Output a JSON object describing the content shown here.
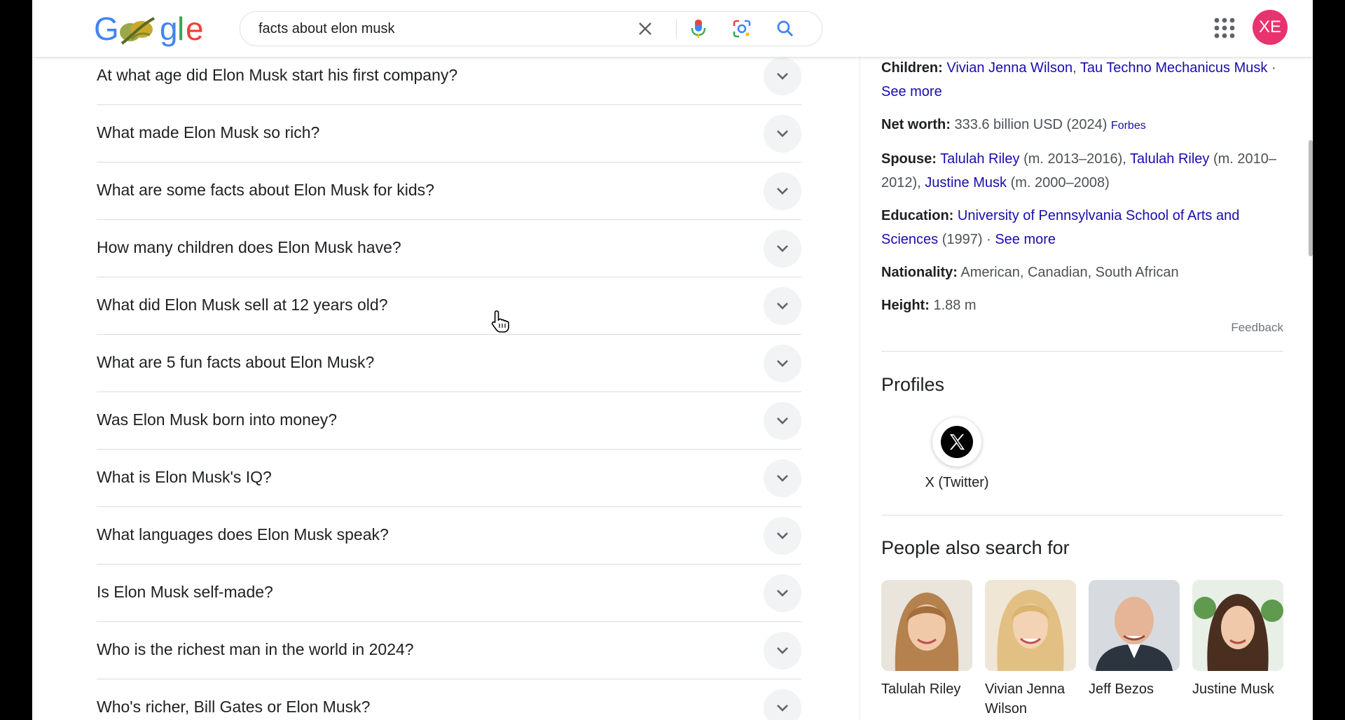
{
  "header": {
    "logo_text": "Google",
    "search_query": "facts about elon musk",
    "avatar_initials": "XE",
    "avatar_color": "#e8336e",
    "icons": [
      "clear-icon",
      "mic-icon",
      "lens-icon",
      "search-icon",
      "apps-icon"
    ]
  },
  "paa": {
    "questions": [
      "At what age did Elon Musk start his first company?",
      "What made Elon Musk so rich?",
      "What are some facts about Elon Musk for kids?",
      "How many children does Elon Musk have?",
      "What did Elon Musk sell at 12 years old?",
      "What are 5 fun facts about Elon Musk?",
      "Was Elon Musk born into money?",
      "What is Elon Musk's IQ?",
      "What languages does Elon Musk speak?",
      "Is Elon Musk self-made?",
      "Who is the richest man in the world in 2024?",
      "Who's richer, Bill Gates or Elon Musk?"
    ]
  },
  "knowledge_panel": {
    "children": {
      "label": "Children:",
      "link1": "Vivian Jenna Wilson",
      "sep": ",",
      "link2": "Tau Techno Mechanicus Musk",
      "dot": " · ",
      "see_more": "See more"
    },
    "net_worth": {
      "label": "Net worth:",
      "value": "333.6 billion USD (2024)",
      "source": "Forbes"
    },
    "spouse": {
      "label": "Spouse:",
      "s1": "Talulah Riley",
      "s1_years": "(m. 2013–2016),",
      "s2": "Talulah Riley",
      "s2_years": "(m. 2010–2012),",
      "s3": "Justine Musk",
      "s3_years": "(m. 2000–2008)"
    },
    "education": {
      "label": "Education:",
      "school": "University of Pennsylvania School of Arts and Sciences",
      "year": "(1997)",
      "dot": " · ",
      "see_more": "See more"
    },
    "nationality": {
      "label": "Nationality:",
      "value": "American, Canadian, South African"
    },
    "height": {
      "label": "Height:",
      "value": "1.88 m"
    },
    "feedback": "Feedback",
    "profiles_title": "Profiles",
    "profiles": [
      {
        "name": "X (Twitter)",
        "icon": "x-logo-icon"
      }
    ],
    "people_title": "People also search for",
    "people": [
      {
        "name": "Talulah Riley",
        "bg": "#c98e5f"
      },
      {
        "name": "Vivian Jenna Wilson",
        "bg": "#e7c690"
      },
      {
        "name": "Jeff Bezos",
        "bg": "#5a6373"
      },
      {
        "name": "Justine Musk",
        "bg": "#5e7c4f"
      }
    ]
  }
}
